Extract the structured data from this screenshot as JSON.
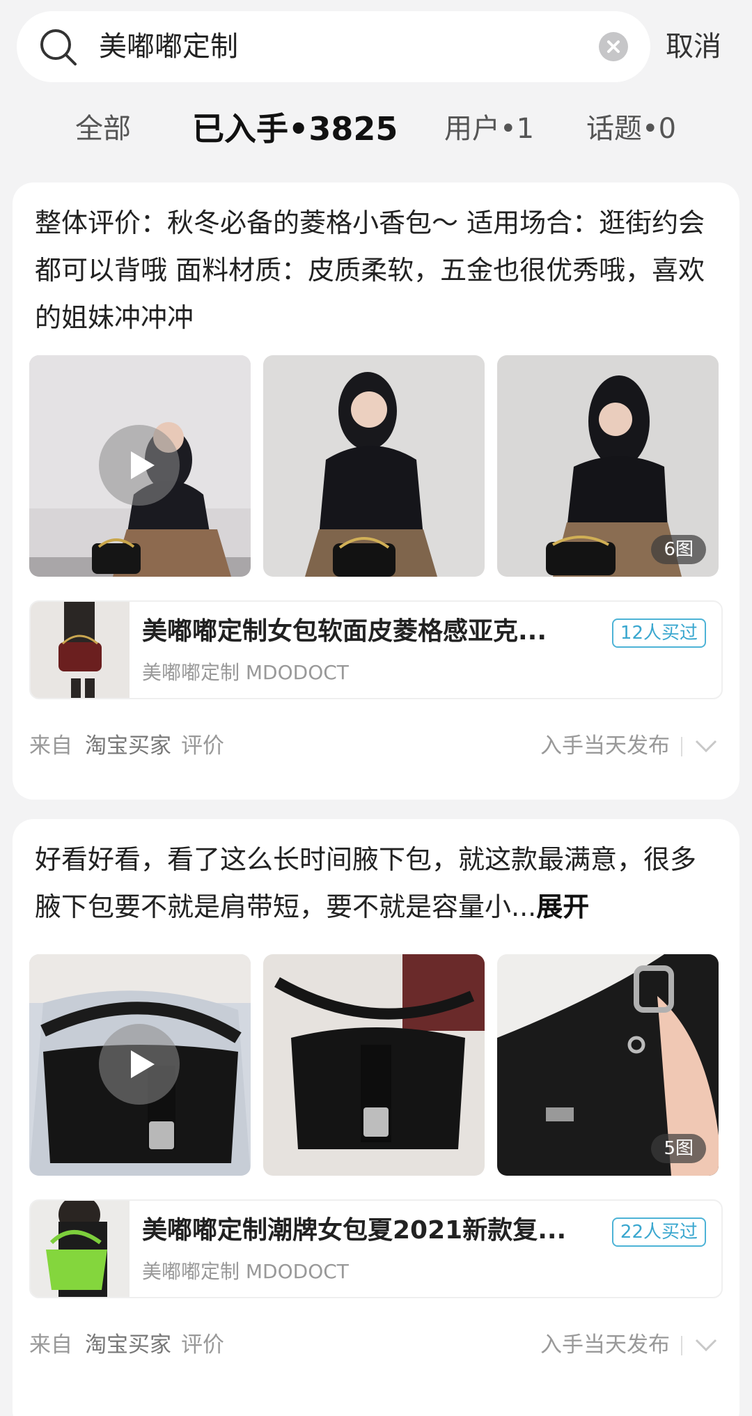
{
  "search": {
    "query": "美嘟嘟定制",
    "cancel_label": "取消"
  },
  "tabs": [
    {
      "label": "全部"
    },
    {
      "label": "已入手•3825"
    },
    {
      "label": "用户•1"
    },
    {
      "label": "话题•0"
    }
  ],
  "posts": [
    {
      "text": "整体评价：秋冬必备的菱格小香包～ 适用场合：逛街约会都可以背哦 面料材质：皮质柔软，五金也很优秀哦，喜欢的姐妹冲冲冲",
      "expand_label": "",
      "photo_count": "6图",
      "product": {
        "title": "美嘟嘟定制女包软面皮菱格感亚克...",
        "shop": "美嘟嘟定制 MDODOCT",
        "bought": "12人买过"
      },
      "footer": {
        "from": "来自",
        "platform": "淘宝买家",
        "type": "评价",
        "publish": "入手当天发布"
      }
    },
    {
      "text": "好看好看，看了这么长时间腋下包，就这款最满意，很多腋下包要不就是肩带短，要不就是容量小...",
      "expand_label": "展开",
      "photo_count": "5图",
      "product": {
        "title": "美嘟嘟定制潮牌女包夏2021新款复...",
        "shop": "美嘟嘟定制 MDODOCT",
        "bought": "22人买过"
      },
      "footer": {
        "from": "来自",
        "platform": "淘宝买家",
        "type": "评价",
        "publish": "入手当天发布"
      }
    }
  ],
  "colors": {
    "accent": "#3aa7cf",
    "background": "#f3f3f4"
  }
}
